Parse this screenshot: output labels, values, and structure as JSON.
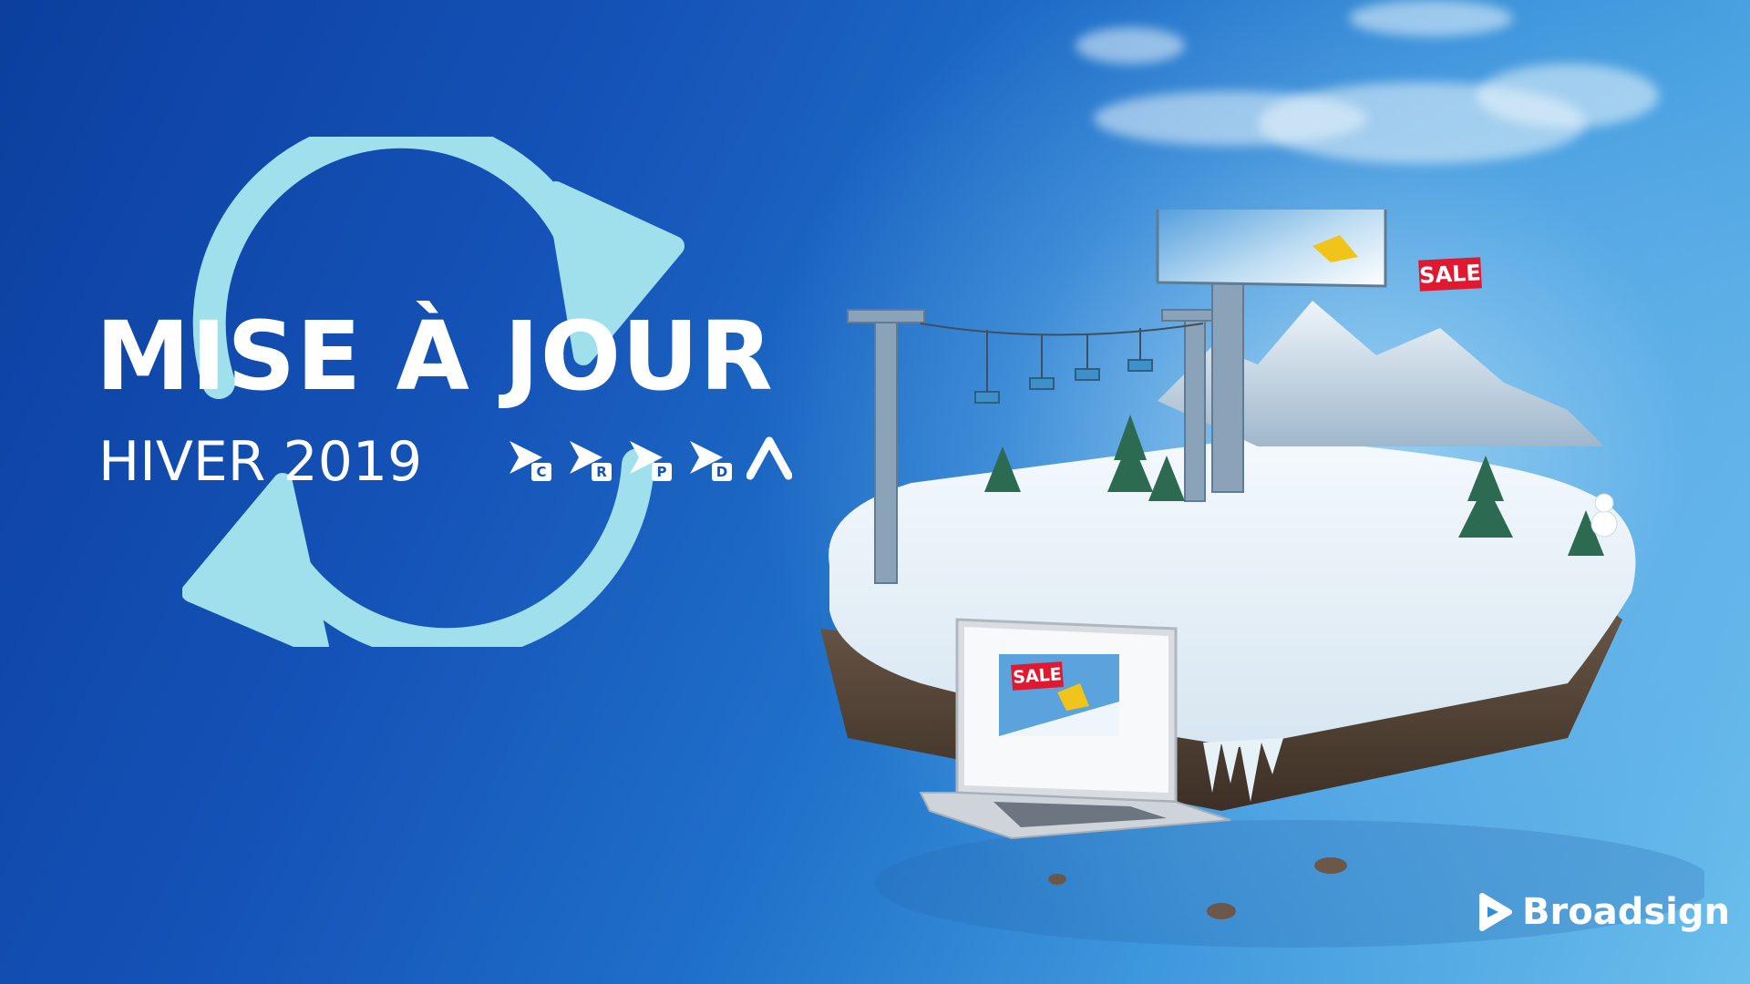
{
  "headline": {
    "title": "MISE À JOUR",
    "subtitle": "HIVER 2019"
  },
  "product_icons": [
    {
      "letter": "C",
      "icon": "play-arrow-c-icon"
    },
    {
      "letter": "R",
      "icon": "play-arrow-r-icon"
    },
    {
      "letter": "P",
      "icon": "play-arrow-p-icon"
    },
    {
      "letter": "D",
      "icon": "play-arrow-d-icon"
    },
    {
      "letter": "",
      "icon": "chevron-up-a-icon"
    }
  ],
  "scene": {
    "billboard_label": "SALE",
    "laptop_label": "SALE"
  },
  "brand": {
    "name": "Broadsign",
    "logo_icon": "broadsign-play-icon"
  },
  "colors": {
    "background_dark": "#0c3f9e",
    "background_light": "#6cbfec",
    "arrow": "#9fe0ec",
    "sale_red": "#e01830",
    "text": "#ffffff"
  }
}
